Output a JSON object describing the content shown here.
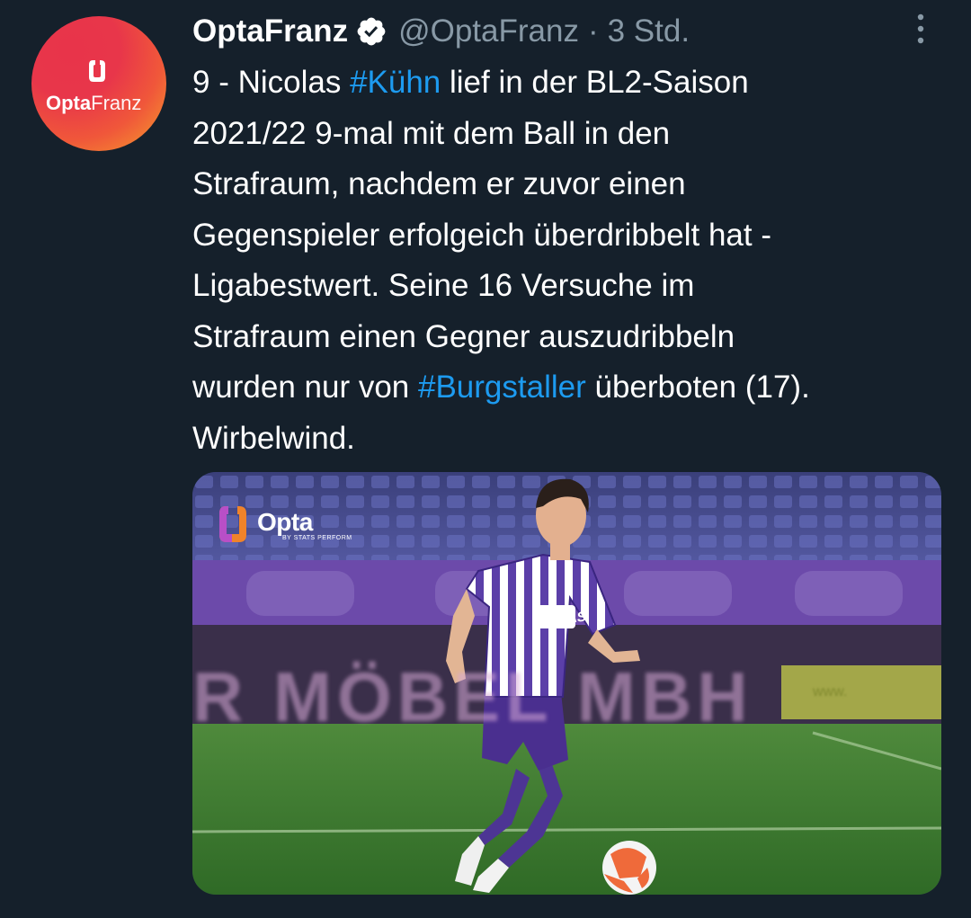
{
  "tweet": {
    "display_name": "OptaFranz",
    "handle": "@OptaFranz",
    "separator": "·",
    "timestamp": "3 Std.",
    "verified": true,
    "avatar": {
      "word_bold": "Opta",
      "word_light": "Franz"
    },
    "text_lines": [
      {
        "before": "9 - Nicolas ",
        "tag": "#Kühn",
        "after": " lief in der BL2-Saison"
      },
      {
        "before": "2021/22 9-mal mit dem Ball in den",
        "tag": "",
        "after": ""
      },
      {
        "before": "Strafraum, nachdem er zuvor einen",
        "tag": "",
        "after": ""
      },
      {
        "before": "Gegenspieler erfolgeich überdribbelt hat -",
        "tag": "",
        "after": ""
      },
      {
        "before": "Ligabestwert. Seine 16 Versuche im",
        "tag": "",
        "after": ""
      },
      {
        "before": "Strafraum einen Gegner auszudribbeln",
        "tag": "",
        "after": ""
      },
      {
        "before": "wurden nur von ",
        "tag": "#Burgstaller",
        "after": " überboten (17)."
      },
      {
        "before": "Wirbelwind.",
        "tag": "",
        "after": ""
      }
    ],
    "media": {
      "watermark_title": "Opta",
      "watermark_subtitle": "BY STATS PERFORM",
      "board_text": "R MÖBEL  MBH",
      "board_url": "www.",
      "shirt_sponsor": "WÄTAS"
    }
  },
  "colors": {
    "background": "#15202b",
    "hashtag": "#1d9bf0",
    "secondary_text": "#8899a6",
    "jersey_purple": "#5b3fa8"
  },
  "icons": {
    "verified": "verified-badge-icon",
    "more": "more-options-icon"
  }
}
